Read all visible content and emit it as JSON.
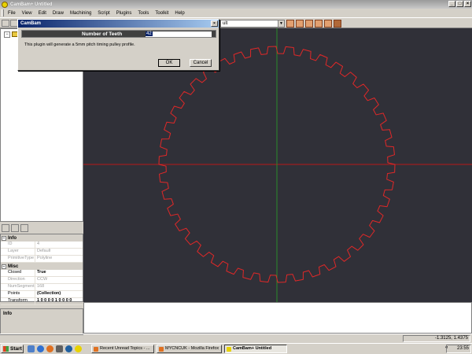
{
  "window": {
    "title": "CamBam+ Untitled",
    "min": "_",
    "max": "□",
    "close": "×"
  },
  "menu": [
    "File",
    "View",
    "Edit",
    "Draw",
    "Machining",
    "Script",
    "Plugins",
    "Tools",
    "Toolkit",
    "Help"
  ],
  "toolbar": {
    "layer_value": "ult",
    "dropdown_arrow": "▼"
  },
  "tree": {
    "expander": "−"
  },
  "properties": {
    "categories": {
      "info": "Info",
      "misc": "Misc"
    },
    "expander": "−",
    "rows": {
      "id": {
        "label": "ID",
        "value": "4"
      },
      "layer": {
        "label": "Layer",
        "value": "Default"
      },
      "primitive_type": {
        "label": "PrimitiveType",
        "value": "Polyline"
      },
      "closed": {
        "label": "Closed",
        "value": "True"
      },
      "direction": {
        "label": "Direction",
        "value": "CCW"
      },
      "num_segments": {
        "label": "NumSegment",
        "value": "168"
      },
      "points": {
        "label": "Points",
        "value": "(Collection)"
      },
      "transform": {
        "label": "Transform",
        "value": "1 0 0 0 0 1 0 0 0 0"
      }
    }
  },
  "info_panel": {
    "label": "Info"
  },
  "dialog": {
    "title": "CamBam",
    "close": "×",
    "prompt": "Number of Teeth",
    "value": "42",
    "description": "This plugin will generate a 5mm pitch timing pulley profile.",
    "ok": "OK",
    "cancel": "Cancel"
  },
  "statusbar": {
    "coords": "-1.3125, 1.4375"
  },
  "taskbar": {
    "start": "Start",
    "tasks": [
      "Recent Unread Topics - ...",
      "MYCNCUK - Mozilla Firefox",
      "CamBam+ Untitled"
    ],
    "tray_arrow": "«",
    "clock": "23:55"
  },
  "pulley": {
    "teeth": 42,
    "axis_color": "#b81818",
    "y_axis_color": "#2a8a2a",
    "profile_color": "#e02828",
    "background": "#303038"
  },
  "icons": [
    "app-icon",
    "minimize-icon",
    "maximize-icon",
    "close-icon",
    "folder-icon",
    "windows-flag-icon"
  ]
}
